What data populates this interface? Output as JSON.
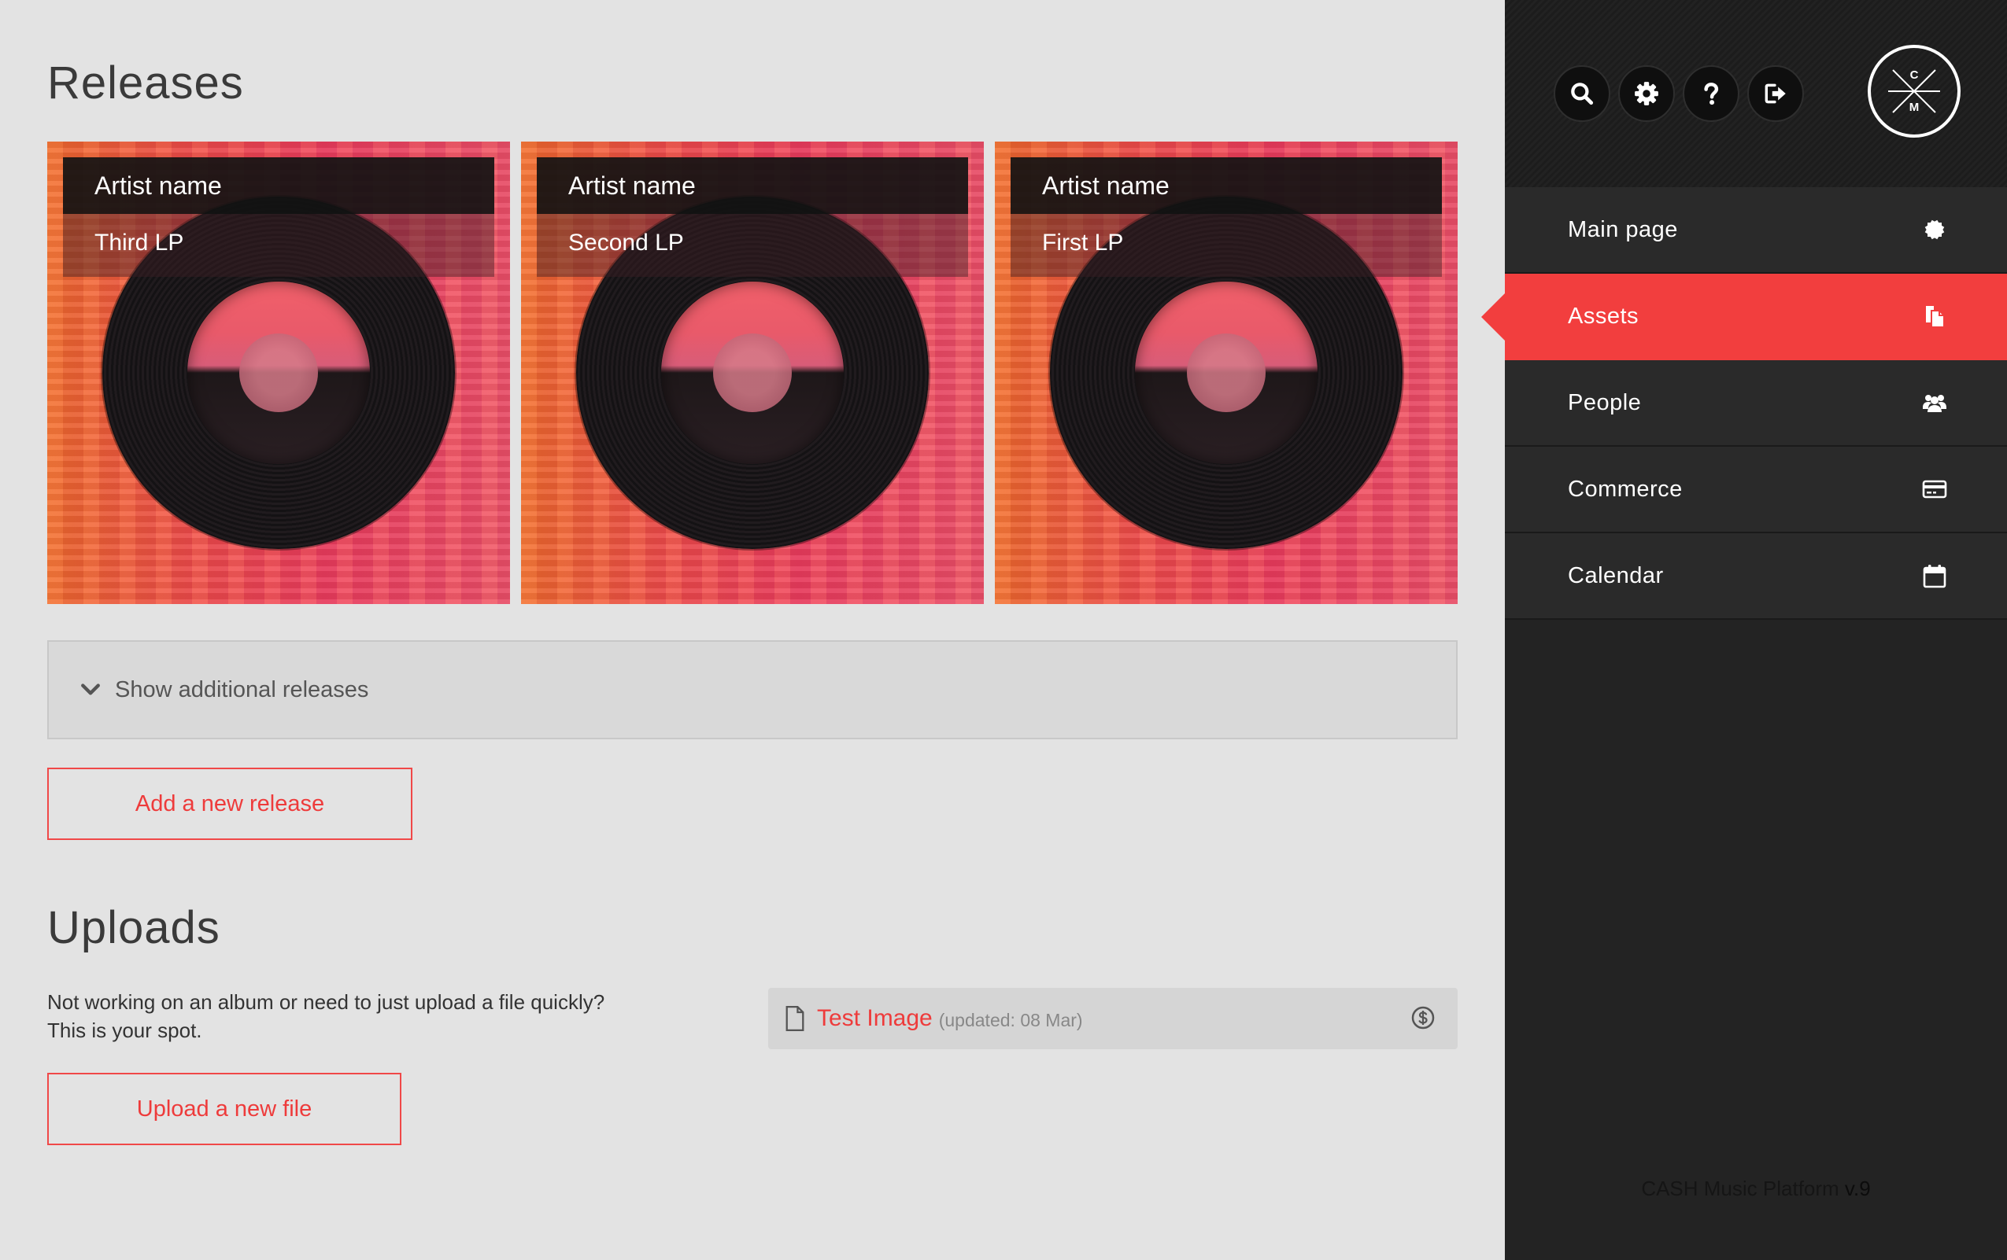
{
  "main": {
    "releases_title": "Releases",
    "releases": [
      {
        "artist": "Artist name",
        "title": "Third LP"
      },
      {
        "artist": "Artist name",
        "title": "Second LP"
      },
      {
        "artist": "Artist name",
        "title": "First LP"
      }
    ],
    "show_more_label": "Show additional releases",
    "add_release_label": "Add a new release",
    "uploads_title": "Uploads",
    "uploads_desc_line1": "Not working on an album or need to just upload a file quickly?",
    "uploads_desc_line2": "This is your spot.",
    "upload_button_label": "Upload a new file",
    "files": [
      {
        "name": "Test Image",
        "meta": "(updated: 08 Mar)"
      }
    ]
  },
  "sidebar": {
    "tools": [
      {
        "icon": "search-icon"
      },
      {
        "icon": "gear-icon"
      },
      {
        "icon": "help-icon"
      },
      {
        "icon": "logout-icon"
      }
    ],
    "logo_text_top": "C",
    "logo_text_bottom": "M",
    "nav": [
      {
        "label": "Main page",
        "icon": "badge-icon",
        "active": false
      },
      {
        "label": "Assets",
        "icon": "files-icon",
        "active": true
      },
      {
        "label": "People",
        "icon": "people-icon",
        "active": false
      },
      {
        "label": "Commerce",
        "icon": "credit-card-icon",
        "active": false
      },
      {
        "label": "Calendar",
        "icon": "calendar-icon",
        "active": false
      }
    ],
    "version_prefix": "CASH Music Platform ",
    "version_number": "v.9"
  },
  "colors": {
    "accent": "#f23e3e",
    "sidebar_bg": "#232323",
    "main_bg": "#e3e3e3"
  }
}
